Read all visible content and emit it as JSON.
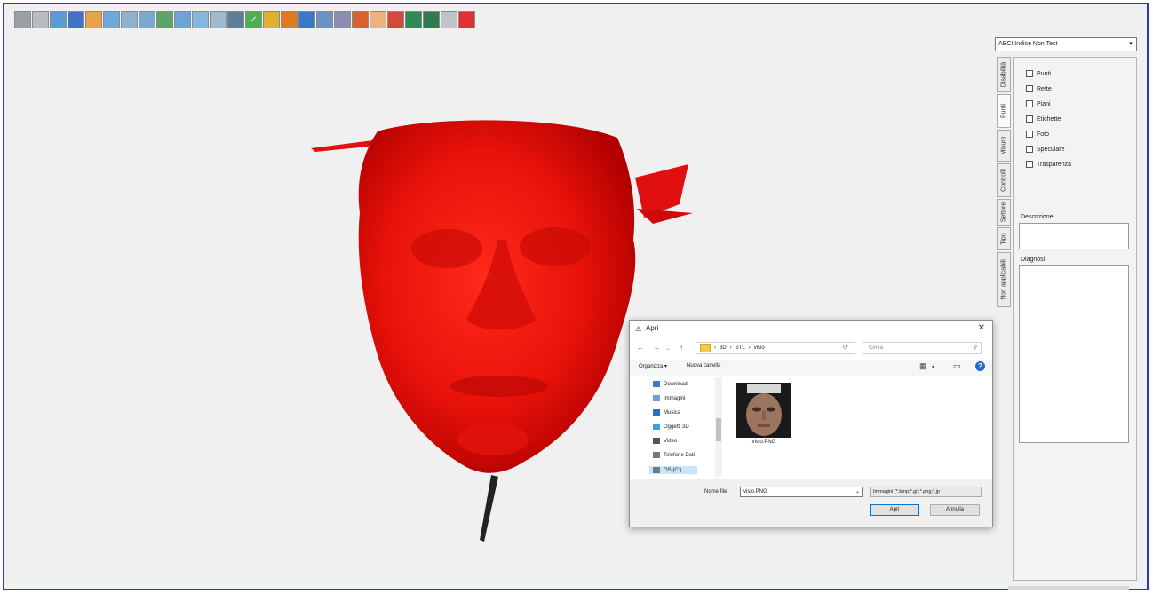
{
  "toolbar": {
    "buttons": [
      {
        "name": "tb-btn-1",
        "color": "#9aa0a6",
        "glyph": ""
      },
      {
        "name": "tb-btn-2",
        "color": "#b8bcc0",
        "glyph": ""
      },
      {
        "name": "tb-btn-3",
        "color": "#5b9bd5",
        "glyph": ""
      },
      {
        "name": "tb-btn-4",
        "color": "#4472c4",
        "glyph": ""
      },
      {
        "name": "tb-btn-5",
        "color": "#e8a24a",
        "glyph": ""
      },
      {
        "name": "tb-btn-6",
        "color": "#6fa8dc",
        "glyph": ""
      },
      {
        "name": "tb-btn-7",
        "color": "#8fb0d0",
        "glyph": ""
      },
      {
        "name": "tb-btn-8",
        "color": "#77aacc",
        "glyph": ""
      },
      {
        "name": "tb-btn-9",
        "color": "#5fa36b",
        "glyph": ""
      },
      {
        "name": "tb-btn-10",
        "color": "#6da3d6",
        "glyph": ""
      },
      {
        "name": "tb-btn-11",
        "color": "#86b5dd",
        "glyph": ""
      },
      {
        "name": "tb-btn-12",
        "color": "#9fb9cf",
        "glyph": ""
      },
      {
        "name": "tb-btn-13",
        "color": "#5d7f96",
        "glyph": ""
      },
      {
        "name": "tb-btn-14",
        "color": "#4caf50",
        "glyph": "✓"
      },
      {
        "name": "tb-btn-15",
        "color": "#e0b030",
        "glyph": ""
      },
      {
        "name": "tb-btn-16",
        "color": "#e07a20",
        "glyph": ""
      },
      {
        "name": "tb-btn-17",
        "color": "#3a78c8",
        "glyph": ""
      },
      {
        "name": "tb-btn-18",
        "color": "#6a95c2",
        "glyph": ""
      },
      {
        "name": "tb-btn-19",
        "color": "#8a8fb0",
        "glyph": ""
      },
      {
        "name": "tb-btn-20",
        "color": "#d96030",
        "glyph": ""
      },
      {
        "name": "tb-btn-21",
        "color": "#f0b080",
        "glyph": ""
      },
      {
        "name": "tb-btn-22",
        "color": "#d24a3a",
        "glyph": ""
      },
      {
        "name": "tb-btn-23",
        "color": "#2e8b57",
        "glyph": ""
      },
      {
        "name": "tb-btn-24",
        "color": "#2f7a4f",
        "glyph": ""
      },
      {
        "name": "tb-btn-25",
        "color": "#c0c4c8",
        "glyph": ""
      },
      {
        "name": "tb-btn-26",
        "color": "#e03030",
        "glyph": ""
      }
    ]
  },
  "panel": {
    "select_value": "ABCI Indice Non Test",
    "tabs": [
      "Disabilità",
      "Punti",
      "Misure",
      "Controlli",
      "Settore",
      "Tipo",
      "Non applicabili"
    ],
    "checkboxes": [
      "Punti",
      "Rette",
      "Piani",
      "Etichette",
      "Foto",
      "Speculare",
      "Trasparenza"
    ],
    "description_label": "Descrizione",
    "diagnosis_label": "Diagnosi"
  },
  "dialog": {
    "title": "Apri",
    "close_glyph": "✕",
    "back_glyph": "←",
    "forward_glyph": "→",
    "up_glyph": "↑",
    "path": [
      "3D",
      "STL",
      "visio"
    ],
    "search_placeholder": "Cerca",
    "organize_label": "Organizza ▾",
    "new_folder_label": "Nuova cartella",
    "nav_items": [
      {
        "label": "Download",
        "color": "#3a78c8"
      },
      {
        "label": "Immagini",
        "color": "#6aa0d8"
      },
      {
        "label": "Musica",
        "color": "#2a70c0"
      },
      {
        "label": "Oggetti 3D",
        "color": "#3fa0e0"
      },
      {
        "label": "Video",
        "color": "#555555"
      },
      {
        "label": "Telefono Dati",
        "color": "#777777"
      },
      {
        "label": "OS (C:)",
        "color": "#6a7a8a"
      }
    ],
    "file_name_shown": "visio.PNG",
    "filename_label": "Nome file:",
    "filename_value": "visio.PNG",
    "filter_value": "Immagini (*.bmp;*.gif;*.png;*.jp",
    "open_label": "Apri",
    "cancel_label": "Annulla"
  }
}
